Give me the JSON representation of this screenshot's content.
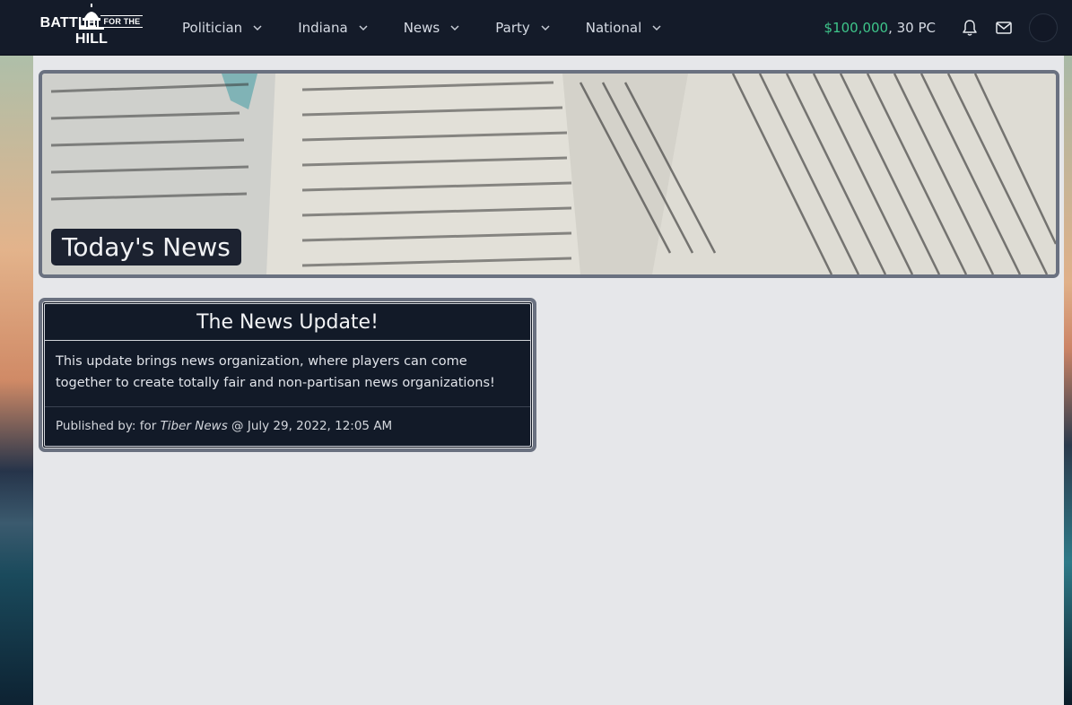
{
  "brand": {
    "logo_text_main1": "BATTLE",
    "logo_text_small": "FOR THE",
    "logo_text_main2": "HILL"
  },
  "nav": {
    "items": [
      {
        "label": "Politician",
        "icon": "chevron-down-icon"
      },
      {
        "label": "Indiana",
        "icon": "chevron-down-icon"
      },
      {
        "label": "News",
        "icon": "chevron-down-icon"
      },
      {
        "label": "Party",
        "icon": "chevron-down-icon"
      },
      {
        "label": "National",
        "icon": "chevron-down-icon"
      }
    ],
    "money": "$100,000",
    "pc": ", 30 PC",
    "icons": [
      "bell-icon",
      "mail-icon",
      "avatar"
    ]
  },
  "hero": {
    "title": "Today's News"
  },
  "article": {
    "title": "The News Update!",
    "body": "This update brings news organization, where players can come together to create totally fair and non-partisan news organizations!",
    "published_prefix": "Published by: for ",
    "publisher": "Tiber News",
    "published_date": " @ July 29, 2022, 12:05 AM"
  },
  "colors": {
    "navbar": "#141b29",
    "money": "#3ec58a",
    "card_bg": "#121a28",
    "border": "#6a7180"
  }
}
